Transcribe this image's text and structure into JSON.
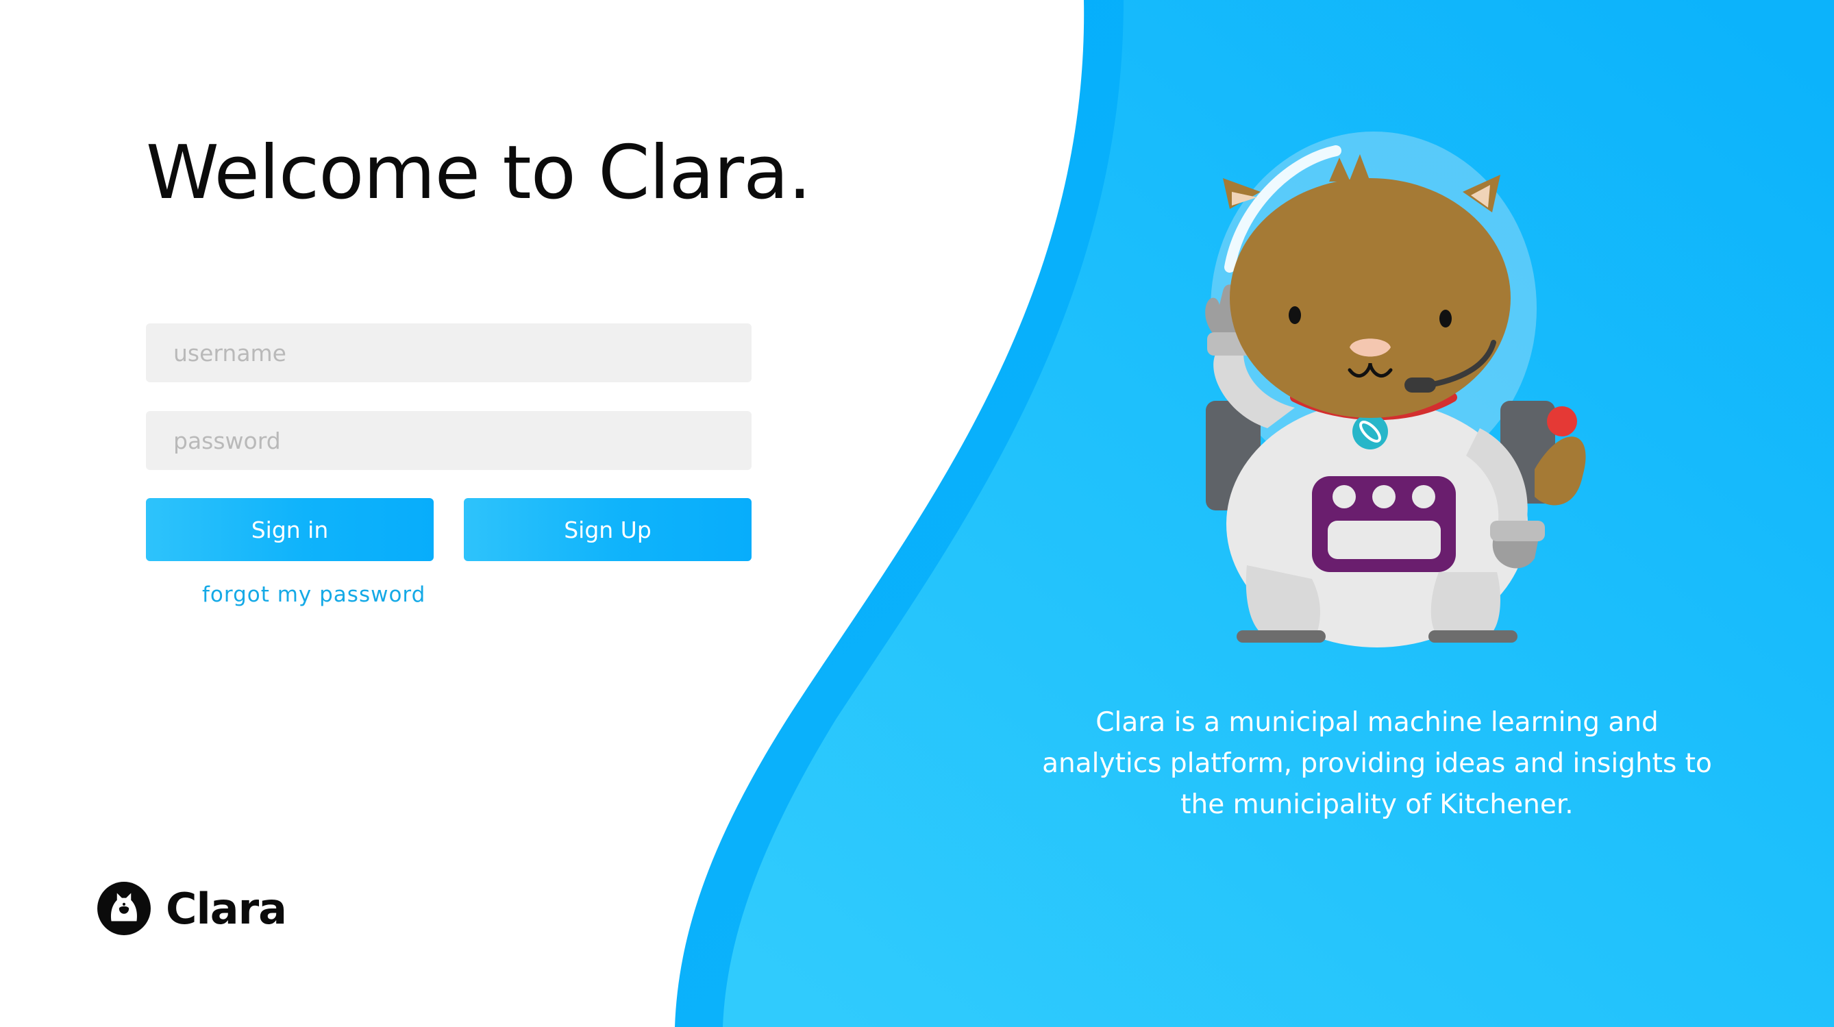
{
  "login": {
    "title": "Welcome to Clara.",
    "username_placeholder": "username",
    "password_placeholder": "password",
    "signin_label": "Sign in",
    "signup_label": "Sign Up",
    "forgot_label": "forgot my password"
  },
  "brand": {
    "name": "Clara",
    "icon": "cat-logo-icon"
  },
  "hero": {
    "mascot": "astronaut-cat-illustration",
    "tagline": "Clara is a municipal machine learning and analytics platform, providing ideas and insights to the municipality of Kitchener."
  },
  "colors": {
    "accent": "#0fb3fb",
    "accent_light": "#33ccfc",
    "link": "#14a9e6",
    "input_bg": "#f0f0f0"
  }
}
